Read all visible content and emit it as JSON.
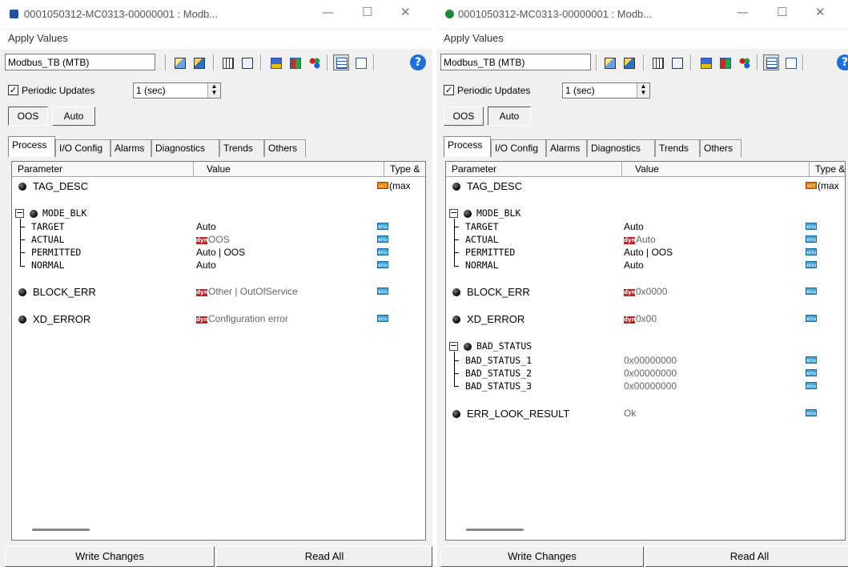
{
  "windows": [
    {
      "title": "0001050312-MC0313-00000001 : Modb...",
      "menu_label": "Apply Values",
      "device_name": "Modbus_TB (MTB)",
      "periodic_label": "Periodic Updates",
      "periodic_checked": "✓",
      "rate_value": "1 (sec)",
      "mode_oos": "OOS",
      "mode_auto": "Auto",
      "tabs": [
        "Process",
        "I/O Config",
        "Alarms",
        "Diagnostics",
        "Trends",
        "Others"
      ],
      "col_param": "Parameter",
      "col_value": "Value",
      "col_type": "Type &",
      "rows": {
        "tag_desc": "TAG_DESC",
        "tag_desc_type_tag": "oct",
        "tag_desc_type_extra": "(max",
        "mode_blk": "MODE_BLK",
        "target": "TARGET",
        "target_value": "Auto",
        "actual": "ACTUAL",
        "actual_value": "OOS",
        "permitted": "PERMITTED",
        "permitted_value": "Auto | OOS",
        "normal": "NORMAL",
        "normal_value": "Auto",
        "block_err": "BLOCK_ERR",
        "block_err_value": "Other | OutOfService",
        "xd_error": "XD_ERROR",
        "xd_error_value": "Configuration error",
        "dyn_tag": "dyn",
        "type_tag": "enu"
      },
      "write_changes": "Write Changes",
      "read_all": "Read All"
    },
    {
      "title": "0001050312-MC0313-00000001 : Modb...",
      "menu_label": "Apply Values",
      "device_name": "Modbus_TB (MTB)",
      "periodic_label": "Periodic Updates",
      "periodic_checked": "✓",
      "rate_value": "1 (sec)",
      "mode_oos": "OOS",
      "mode_auto": "Auto",
      "tabs": [
        "Process",
        "I/O Config",
        "Alarms",
        "Diagnostics",
        "Trends",
        "Others"
      ],
      "col_param": "Parameter",
      "col_value": "Value",
      "col_type": "Type &",
      "rows": {
        "tag_desc": "TAG_DESC",
        "tag_desc_type_tag": "oct",
        "tag_desc_type_extra": "(max",
        "mode_blk": "MODE_BLK",
        "target": "TARGET",
        "target_value": "Auto",
        "actual": "ACTUAL",
        "actual_value": "Auto",
        "permitted": "PERMITTED",
        "permitted_value": "Auto | OOS",
        "normal": "NORMAL",
        "normal_value": "Auto",
        "block_err": "BLOCK_ERR",
        "block_err_value": "0x0000",
        "xd_error": "XD_ERROR",
        "xd_error_value": "0x00",
        "bad_status": "BAD_STATUS",
        "bad_status_1": "BAD_STATUS_1",
        "bad_status_1_value": "0x00000000",
        "bad_status_2": "BAD_STATUS_2",
        "bad_status_2_value": "0x00000000",
        "bad_status_3": "BAD_STATUS_3",
        "bad_status_3_value": "0x00000000",
        "err_look_result": "ERR_LOOK_RESULT",
        "err_look_result_value": "Ok",
        "dyn_tag": "dyn",
        "type_tag": "enu"
      },
      "write_changes": "Write Changes",
      "read_all": "Read All"
    }
  ],
  "window_controls": {
    "minimize": "—",
    "maximize": "☐",
    "close": "✕"
  },
  "colors": {
    "dyn_badge": "#c42121",
    "enu_badge": "#3fa3d8",
    "oct_badge": "#e07b00",
    "left_title_icon": "#1f4e9c",
    "right_title_icon": "#1f8a3a"
  },
  "icons": [
    "title-app-icon",
    "edit-icon",
    "edit-all-icon",
    "monitor-icon",
    "compare-icon",
    "save-icon",
    "transfer-icon",
    "dots-icon",
    "list-view-icon",
    "detail-view-icon",
    "help-icon"
  ]
}
